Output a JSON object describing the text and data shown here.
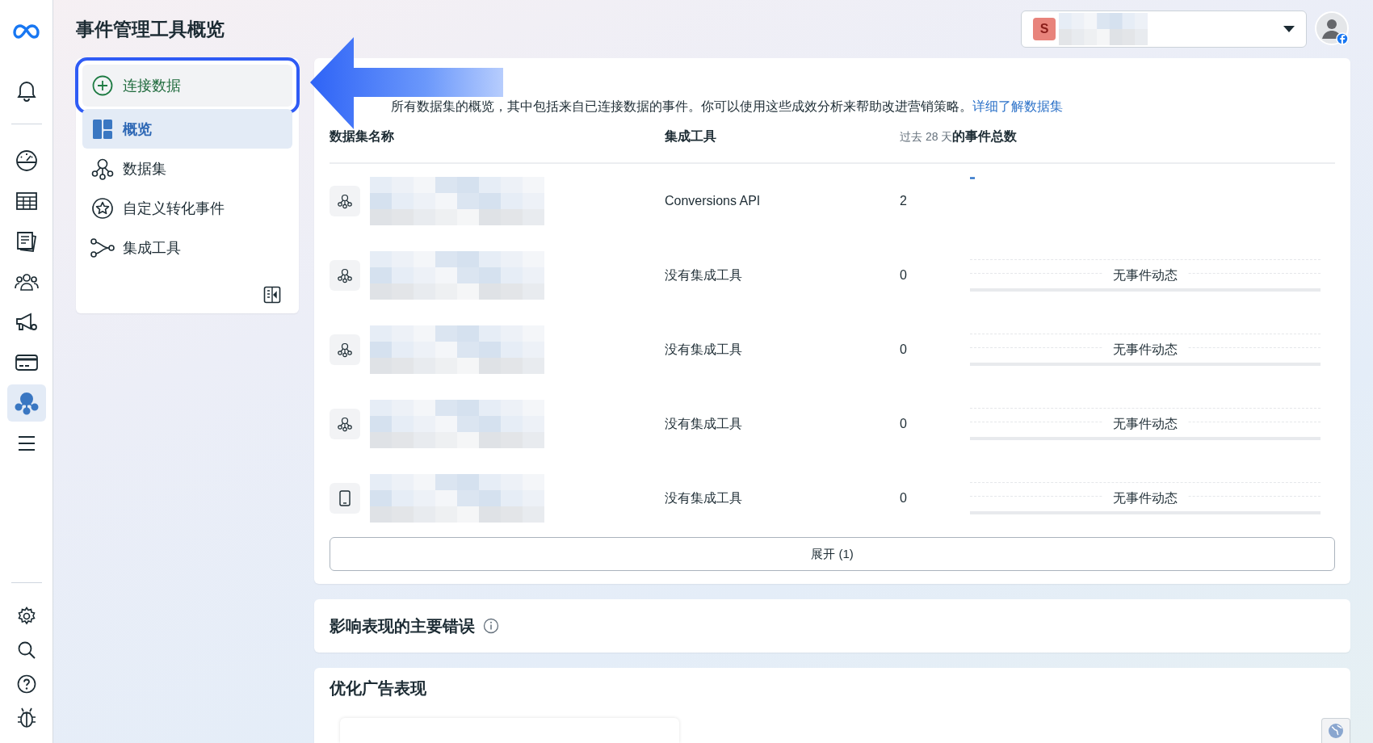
{
  "rail": {
    "items": [
      {
        "selected": false
      },
      {
        "selected": false
      },
      {
        "selected": false
      },
      {
        "selected": false
      },
      {
        "selected": false
      },
      {
        "selected": false
      },
      {
        "selected": false
      },
      {
        "selected": true
      },
      {
        "selected": false
      }
    ]
  },
  "header": {
    "title": "事件管理工具概览",
    "account": {
      "initial": "S",
      "name_redacted": true
    }
  },
  "nav": {
    "items": [
      {
        "kind": "action",
        "label": "连接数据",
        "selected": false,
        "highlighted": true
      },
      {
        "kind": "overview",
        "label": "概览",
        "selected": true,
        "highlighted": false
      },
      {
        "kind": "datasets",
        "label": "数据集",
        "selected": false,
        "highlighted": false
      },
      {
        "kind": "custom",
        "label": "自定义转化事件",
        "selected": false,
        "highlighted": false
      },
      {
        "kind": "integrations",
        "label": "集成工具",
        "selected": false,
        "highlighted": false
      }
    ]
  },
  "overview": {
    "description": "所有数据集的概览，其中包括来自已连接数据的事件。你可以使用这些成效分析来帮助改进营销策略。",
    "link": "详细了解数据集",
    "columns": [
      {
        "label": "数据集名称"
      },
      {
        "label": "集成工具"
      },
      {
        "prefix": "过去 28 天",
        "label": "的事件总数"
      }
    ],
    "rows": [
      {
        "kind": "dataset",
        "name_redacted": true,
        "tool": "Conversions API",
        "count": "2",
        "activity": {
          "kind": "sparkline"
        }
      },
      {
        "kind": "dataset",
        "name_redacted": true,
        "tool": "没有集成工具",
        "count": "0",
        "activity": {
          "kind": "empty",
          "label": "无事件动态"
        }
      },
      {
        "kind": "dataset",
        "name_redacted": true,
        "tool": "没有集成工具",
        "count": "0",
        "activity": {
          "kind": "empty",
          "label": "无事件动态"
        }
      },
      {
        "kind": "dataset",
        "name_redacted": true,
        "tool": "没有集成工具",
        "count": "0",
        "activity": {
          "kind": "empty",
          "label": "无事件动态"
        }
      },
      {
        "kind": "app",
        "name_redacted": true,
        "tool": "没有集成工具",
        "count": "0",
        "activity": {
          "kind": "empty",
          "label": "无事件动态"
        }
      }
    ],
    "expand_button": "展开 (1)"
  },
  "sections": [
    {
      "title": "影响表现的主要错误",
      "info": true
    },
    {
      "title": "优化广告表现",
      "info": false
    }
  ]
}
